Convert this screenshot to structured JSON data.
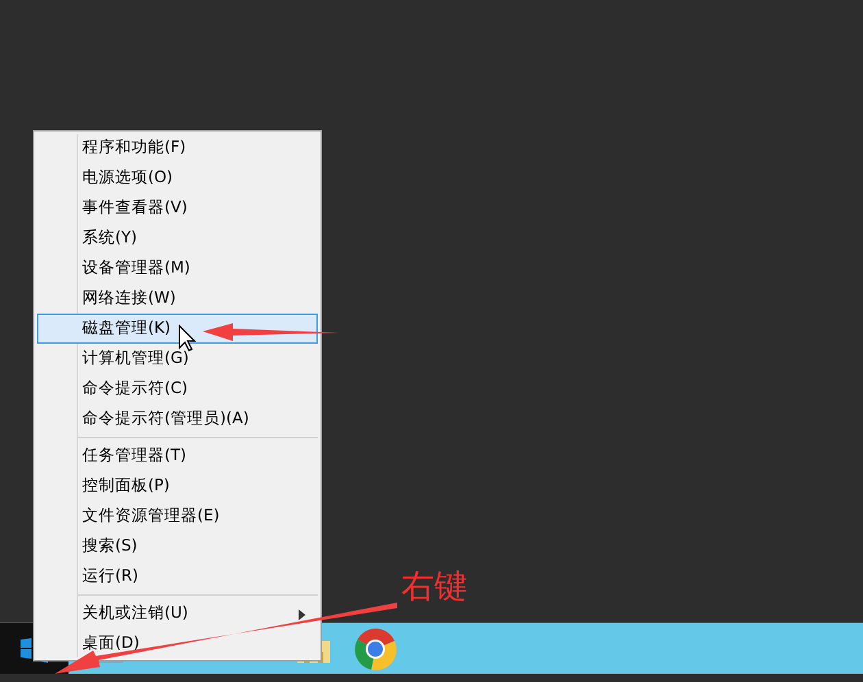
{
  "context_menu": {
    "groups": [
      {
        "items": [
          {
            "label": "程序和功能(F)",
            "selected": false,
            "has_submenu": false
          },
          {
            "label": "电源选项(O)",
            "selected": false,
            "has_submenu": false
          },
          {
            "label": "事件查看器(V)",
            "selected": false,
            "has_submenu": false
          },
          {
            "label": "系统(Y)",
            "selected": false,
            "has_submenu": false
          },
          {
            "label": "设备管理器(M)",
            "selected": false,
            "has_submenu": false
          },
          {
            "label": "网络连接(W)",
            "selected": false,
            "has_submenu": false
          },
          {
            "label": "磁盘管理(K)",
            "selected": true,
            "has_submenu": false
          },
          {
            "label": "计算机管理(G)",
            "selected": false,
            "has_submenu": false
          },
          {
            "label": "命令提示符(C)",
            "selected": false,
            "has_submenu": false
          },
          {
            "label": "命令提示符(管理员)(A)",
            "selected": false,
            "has_submenu": false
          }
        ]
      },
      {
        "items": [
          {
            "label": "任务管理器(T)",
            "selected": false,
            "has_submenu": false
          },
          {
            "label": "控制面板(P)",
            "selected": false,
            "has_submenu": false
          },
          {
            "label": "文件资源管理器(E)",
            "selected": false,
            "has_submenu": false
          },
          {
            "label": "搜索(S)",
            "selected": false,
            "has_submenu": false
          },
          {
            "label": "运行(R)",
            "selected": false,
            "has_submenu": false
          }
        ]
      },
      {
        "items": [
          {
            "label": "关机或注销(U)",
            "selected": false,
            "has_submenu": true
          },
          {
            "label": "桌面(D)",
            "selected": false,
            "has_submenu": false
          }
        ]
      }
    ]
  },
  "annotation": {
    "label": "右键"
  }
}
